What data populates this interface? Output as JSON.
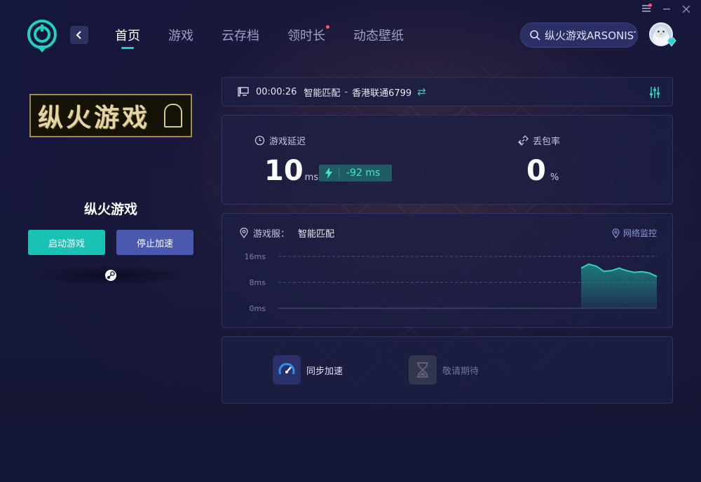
{
  "nav": {
    "items": [
      {
        "label": "首页",
        "active": true
      },
      {
        "label": "游戏",
        "active": false
      },
      {
        "label": "云存档",
        "active": false
      },
      {
        "label": "领时长",
        "active": false,
        "dot": true
      },
      {
        "label": "动态壁纸",
        "active": false
      }
    ]
  },
  "search": {
    "value": "纵火游戏ARSONIST"
  },
  "game": {
    "banner_text": "纵火游戏",
    "name": "纵火游戏",
    "start_label": "启动游戏",
    "stop_label": "停止加速"
  },
  "status": {
    "elapsed": "00:00:26",
    "mode": "智能匹配",
    "separator": "-",
    "server": "香港联通6799"
  },
  "metrics": {
    "latency_label": "游戏延迟",
    "latency_value": "10",
    "latency_unit": "ms",
    "latency_delta": "-92 ms",
    "loss_label": "丢包率",
    "loss_value": "0",
    "loss_unit": "%"
  },
  "chart_header": {
    "server_label": "游戏服：",
    "server_value": "智能匹配",
    "monitor_label": "网络监控"
  },
  "chart_data": {
    "type": "area",
    "y_ticks": [
      "16ms",
      "8ms",
      "0ms"
    ],
    "ylim": [
      0,
      16
    ],
    "grid": true,
    "xlim": [
      0,
      100
    ],
    "series": [
      {
        "x": [
          80,
          82,
          84,
          86,
          88,
          90,
          92,
          94,
          96,
          98,
          100
        ],
        "values": [
          12.4,
          13.6,
          13.0,
          11.4,
          11.6,
          12.4,
          11.6,
          11.1,
          11.3,
          10.9,
          9.8
        ]
      }
    ],
    "colors": {
      "line": "#2fd3bf",
      "fill": "#1f8a86"
    }
  },
  "features": {
    "sync_label": "同步加速",
    "coming_label": "敬请期待"
  }
}
